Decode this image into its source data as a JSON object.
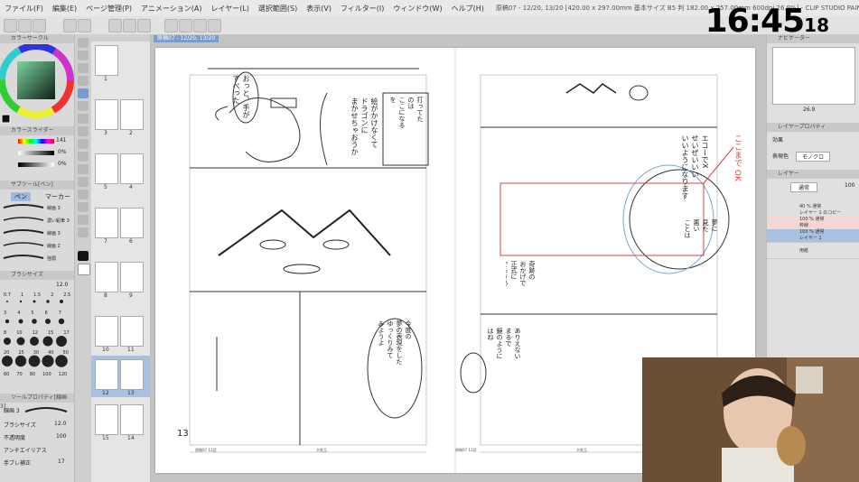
{
  "app": {
    "title": "原稿07 - 12/20, 13/20 [420.00 x 297.00mm 基本サイズ B5 判 182.00 x 257.00mm 600dpi 26.9%] - CLIP STUDIO PAINT EX"
  },
  "menu": {
    "items": [
      "ファイル(F)",
      "編集(E)",
      "ページ管理(P)",
      "アニメーション(A)",
      "レイヤー(L)",
      "選択範囲(S)",
      "表示(V)",
      "フィルター(I)",
      "ウィンドウ(W)",
      "ヘルプ(H)"
    ]
  },
  "clock": {
    "main": "16:45",
    "seconds": "18"
  },
  "document_tab": {
    "label": "原稿07 - 12/20, 13/20"
  },
  "left_panel": {
    "color_wheel_label": "カラーサークル",
    "color_slider_label": "カラースライダー",
    "slider_values": [
      "141",
      "0%",
      "0%"
    ],
    "sub_tool_label": "サブツール[ペン]",
    "pen_tab": "ペン",
    "marker_tab": "マーカー",
    "brushes": [
      "線画 3",
      "濃い鉛筆 3",
      "線画 3",
      "線画 2",
      "強弱"
    ],
    "brush_size_label": "ブラシサイズ",
    "brush_size_value": "12.0",
    "sizes_row1": [
      "0.7",
      "1",
      "1.5",
      "2",
      "2.5"
    ],
    "sizes_row2": [
      "3",
      "4",
      "5",
      "6",
      "7"
    ],
    "sizes_row3": [
      "8",
      "10",
      "12",
      "15",
      "17"
    ],
    "sizes_row4": [
      "20",
      "25",
      "30",
      "40",
      "50"
    ],
    "sizes_row5": [
      "60",
      "70",
      "80",
      "100",
      "120"
    ],
    "tool_property_label": "ツールプロパティ[線画 3]",
    "tool_property_brush": "線画 3",
    "brush_size_prop": "ブラシサイズ",
    "brush_size_prop_value": "12.0",
    "opacity_label": "不透明度",
    "opacity_value": "100",
    "anti_alias_label": "アンチエイリアス",
    "stabilization_label": "手ブレ補正",
    "stabilization_value": "17"
  },
  "page_strip": {
    "pages": [
      "1",
      "3",
      "2",
      "5",
      "4",
      "7",
      "6",
      "8",
      "9",
      "10",
      "11",
      "12",
      "13",
      "15",
      "14"
    ]
  },
  "canvas": {
    "page_number": "13",
    "footer_left": "原稿07 12話",
    "footer_mid": "大蛇玉",
    "footer_right_left": "原稿07 12話",
    "footer_right_mid": "大蛇玉",
    "margin_note": "ここまで OK",
    "bubble_text_1": "おっと、手が\nすべった",
    "bubble_text_2": "絵がかけなくて\nドラゴンに\nまかせちゃおうか",
    "box_text": "打ってた\nのは\nここになる\nを\nまかせ",
    "bubble_text_3": "今度の\n夢の表現をした\nゆっくりみて\nみようよ",
    "speech_right_1": "エコーでX\nせいぜいいい\nいいようになります",
    "speech_right_2": "奇跡の\nおかげで\n正式に\nでもさあ",
    "speech_right_3": "夢に\n見た\n悪い\nことは\nないの?",
    "bottom_left_text": "ありえない\nまるで\n鏡のように\nはね"
  },
  "right_panel": {
    "navigator_label": "ナビゲーター",
    "zoom_value": "26.9",
    "layer_property_label": "レイヤープロパティ",
    "effect_label": "効果",
    "expression_label": "表現色",
    "expression_value": "モノクロ",
    "layer_label": "レイヤー",
    "blend_mode": "通常",
    "opacity": "100",
    "layers": [
      {
        "name": "40 % 通常\nレイヤー 1 のコピー"
      },
      {
        "name": "100 % 通常\n枠線"
      },
      {
        "name": "100 % 通常\nレイヤー 1"
      },
      {
        "name": "用紙"
      }
    ]
  },
  "colors": {
    "ui_bg": "#d6d6d6",
    "selection": "#7a9ccc",
    "red_ink": "#e04040",
    "blue_ink": "#7aa6d6"
  }
}
